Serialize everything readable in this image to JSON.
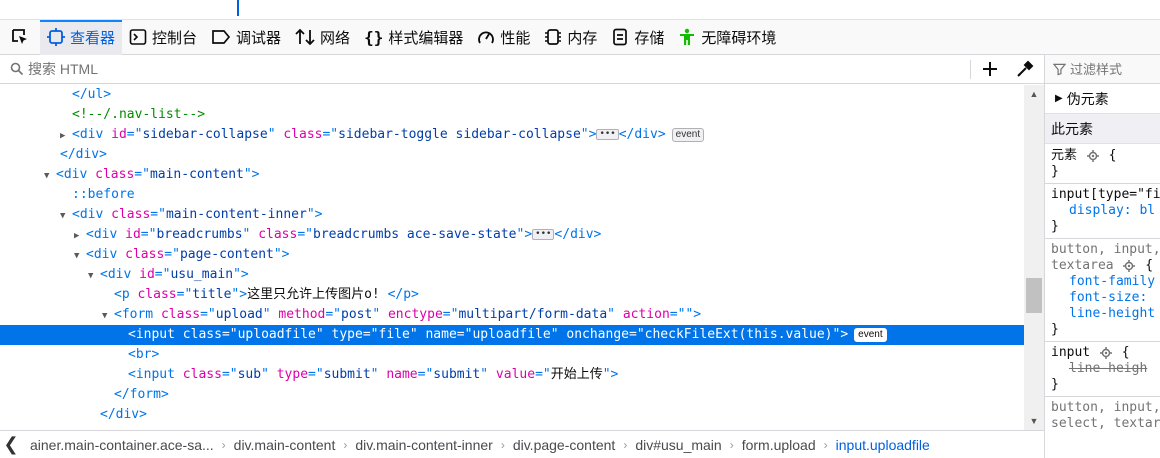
{
  "toolbar": {
    "tabs": [
      {
        "label": "查看器",
        "icon": "inspector-icon"
      },
      {
        "label": "控制台",
        "icon": "console-icon"
      },
      {
        "label": "调试器",
        "icon": "debugger-icon"
      },
      {
        "label": "网络",
        "icon": "network-icon"
      },
      {
        "label": "样式编辑器",
        "icon": "style-editor-icon"
      },
      {
        "label": "性能",
        "icon": "performance-icon"
      },
      {
        "label": "内存",
        "icon": "memory-icon"
      },
      {
        "label": "存储",
        "icon": "storage-icon"
      },
      {
        "label": "无障碍环境",
        "icon": "accessibility-icon"
      }
    ],
    "active_tab": "查看器"
  },
  "search": {
    "placeholder": "搜索 HTML"
  },
  "markup": {
    "l1": "</ul>",
    "l2": "<!--/.nav-list-->",
    "l3_tag": "div",
    "l3_id": "sidebar-collapse",
    "l3_class": "sidebar-toggle sidebar-collapse",
    "l3_badge": "event",
    "l4": "</div>",
    "l5_class": "main-content",
    "l6": "::before",
    "l7_class": "main-content-inner",
    "l8_id": "breadcrumbs",
    "l8_class": "breadcrumbs ace-save-state",
    "l9_class": "page-content",
    "l10_id": "usu_main",
    "l11_class": "title",
    "l11_text": "这里只允许上传图片o! ",
    "l12_class": "upload",
    "l12_method": "post",
    "l12_enctype": "multipart/form-data",
    "l12_action": "",
    "l13_class": "uploadfile",
    "l13_type": "file",
    "l13_name": "uploadfile",
    "l13_onchange": "checkFileExt(this.value)",
    "l13_badge": "event",
    "l14": "<br>",
    "l15_class": "sub",
    "l15_type": "submit",
    "l15_name": "submit",
    "l15_value": "开始上传",
    "l16": "</form>",
    "l17": "</div>"
  },
  "breadcrumbs": {
    "items": [
      "ainer.main-container.ace-sa...",
      "div.main-content",
      "div.main-content-inner",
      "div.page-content",
      "div#usu_main",
      "form.upload",
      "input.uploadfile"
    ]
  },
  "sidebar": {
    "filter_placeholder": "过滤样式",
    "pseudo_label": "伪元素",
    "this_element_label": "此元素",
    "rules": {
      "r1_selector": "元素",
      "r2_selector": "input[type=\"fi",
      "r2_prop": "display: bl",
      "r3_selector": "button, input,",
      "r3_selector2": "textarea",
      "r3_prop1": "font-family",
      "r3_prop2": "font-size:",
      "r3_prop3": "line-height",
      "r4_selector": "input",
      "r4_prop": "line-heigh",
      "r5_selector": "button, input,",
      "r5_selector2": "select, textar"
    }
  },
  "colors": {
    "accent": "#0060df",
    "selection": "#0074e8",
    "tag": "#0074e8",
    "attr": "#dd00a9",
    "value": "#003eaa",
    "comment": "#058b00"
  }
}
